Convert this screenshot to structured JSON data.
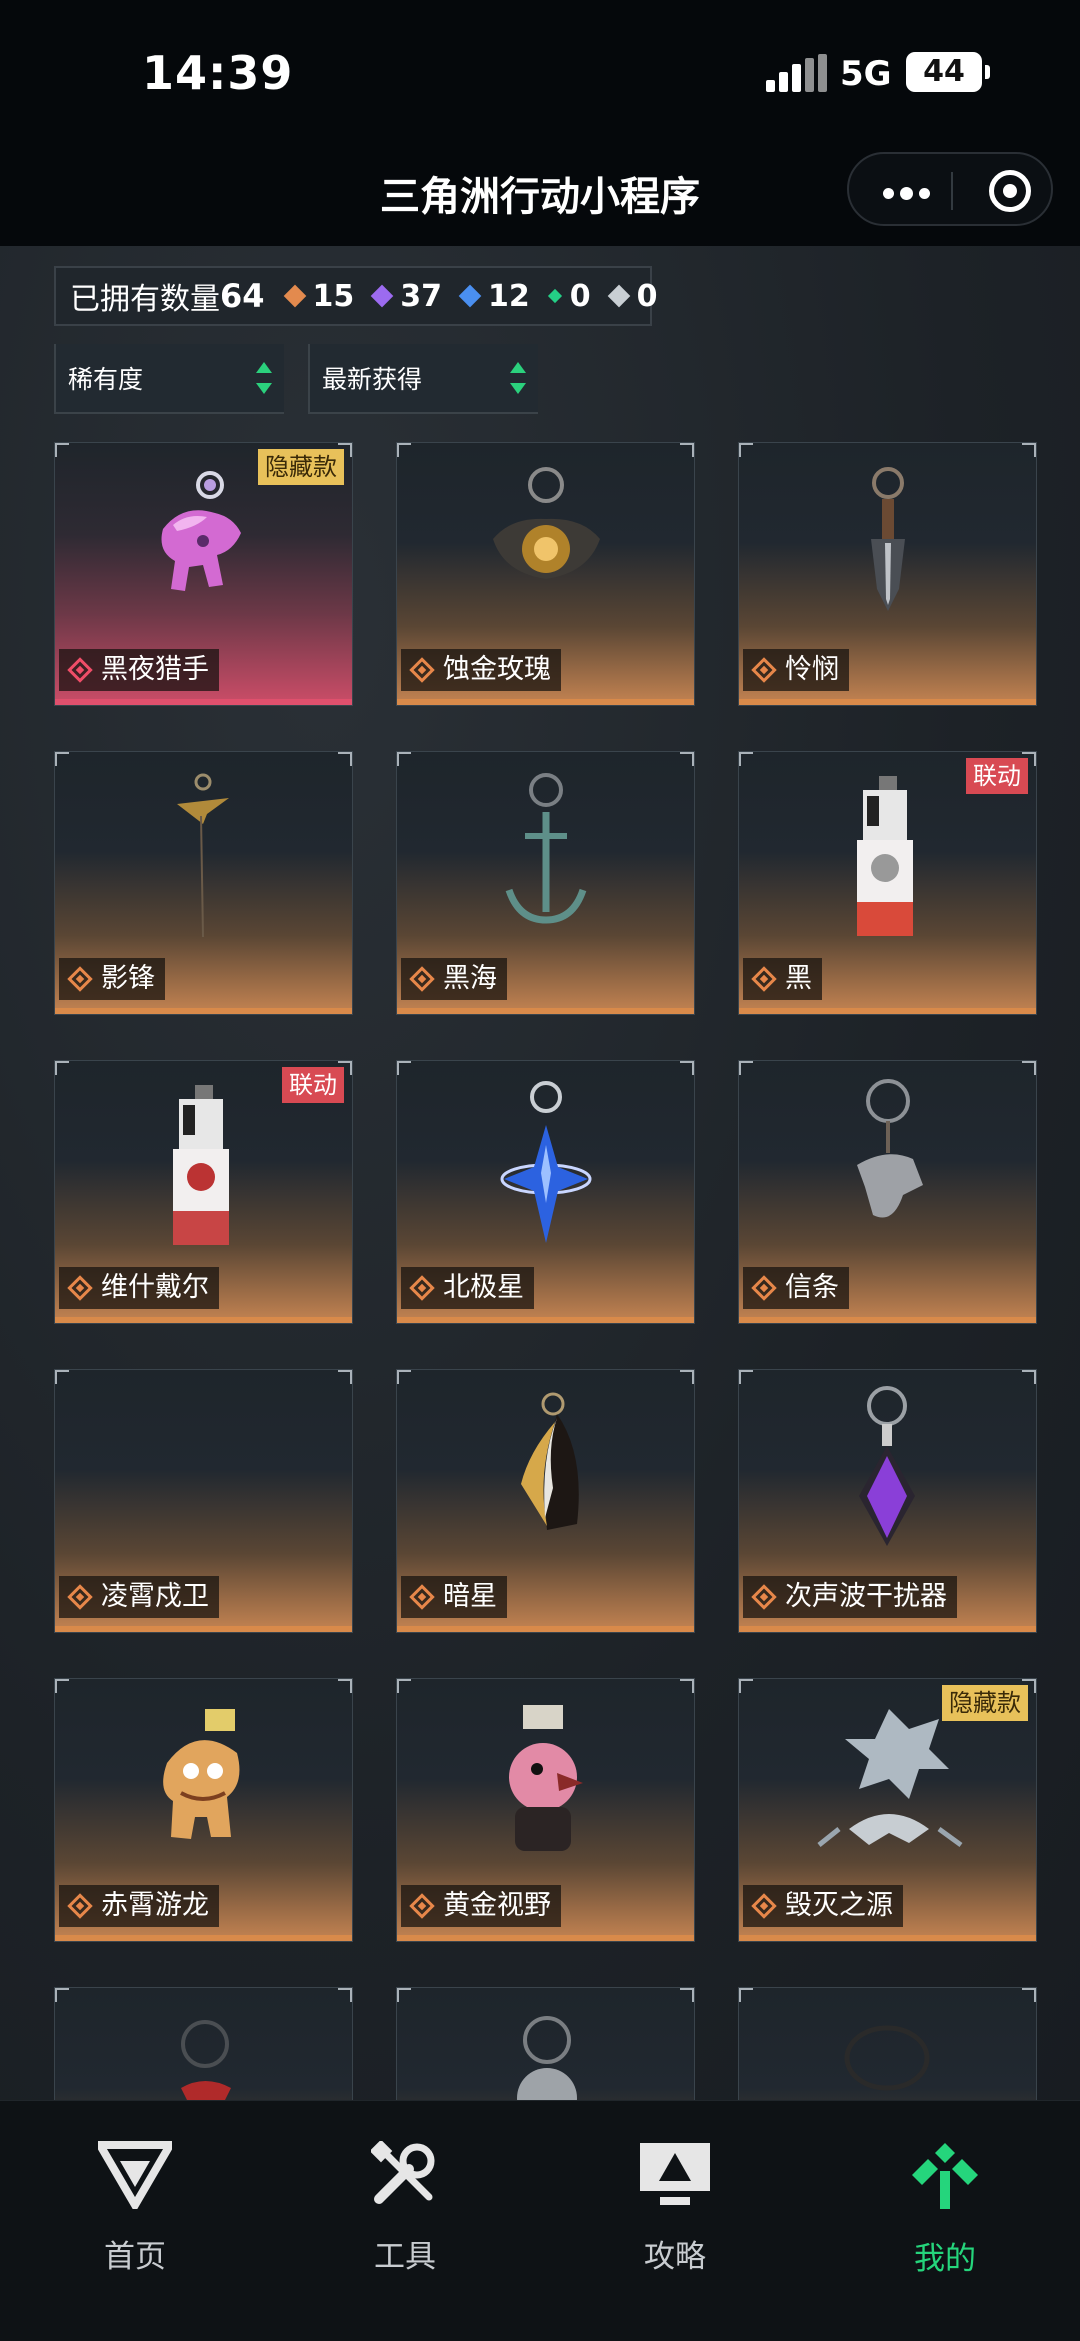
{
  "status": {
    "time": "14:39",
    "network": "5G",
    "battery": "44"
  },
  "header": {
    "title": "三角洲行动小程序"
  },
  "summary": {
    "owned_label": "已拥有数量",
    "owned_count": "64",
    "counts": [
      {
        "value": "15",
        "color": "#e38a4e"
      },
      {
        "value": "37",
        "color": "#9c6bf0"
      },
      {
        "value": "12",
        "color": "#4a8ff0"
      },
      {
        "value": "0",
        "color": "#24cf86"
      },
      {
        "value": "0",
        "color": "#c9cfd4"
      }
    ]
  },
  "filters": {
    "rarity": "稀有度",
    "sort": "最新获得"
  },
  "items": [
    {
      "name": "黑夜猎手",
      "tag": "隐藏款",
      "rarity": "red"
    },
    {
      "name": "蚀金玫瑰",
      "tag": "",
      "rarity": "orange"
    },
    {
      "name": "怜悯",
      "tag": "",
      "rarity": "orange"
    },
    {
      "name": "影锋",
      "tag": "",
      "rarity": "orange"
    },
    {
      "name": "黑海",
      "tag": "",
      "rarity": "orange"
    },
    {
      "name": "黑",
      "tag": "联动",
      "rarity": "orange"
    },
    {
      "name": "维什戴尔",
      "tag": "联动",
      "rarity": "orange"
    },
    {
      "name": "北极星",
      "tag": "",
      "rarity": "orange"
    },
    {
      "name": "信条",
      "tag": "",
      "rarity": "orange"
    },
    {
      "name": "凌霄戍卫",
      "tag": "",
      "rarity": "orange"
    },
    {
      "name": "暗星",
      "tag": "",
      "rarity": "orange"
    },
    {
      "name": "次声波干扰器",
      "tag": "",
      "rarity": "orange"
    },
    {
      "name": "赤霄游龙",
      "tag": "",
      "rarity": "orange"
    },
    {
      "name": "黄金视野",
      "tag": "",
      "rarity": "orange"
    },
    {
      "name": "毁灭之源",
      "tag": "隐藏款",
      "rarity": "orange"
    }
  ],
  "nav": [
    {
      "label": "首页",
      "icon": "home-logo-icon"
    },
    {
      "label": "工具",
      "icon": "tools-icon"
    },
    {
      "label": "攻略",
      "icon": "guide-monitor-icon"
    },
    {
      "label": "我的",
      "icon": "profile-logo-icon",
      "active": true
    }
  ]
}
